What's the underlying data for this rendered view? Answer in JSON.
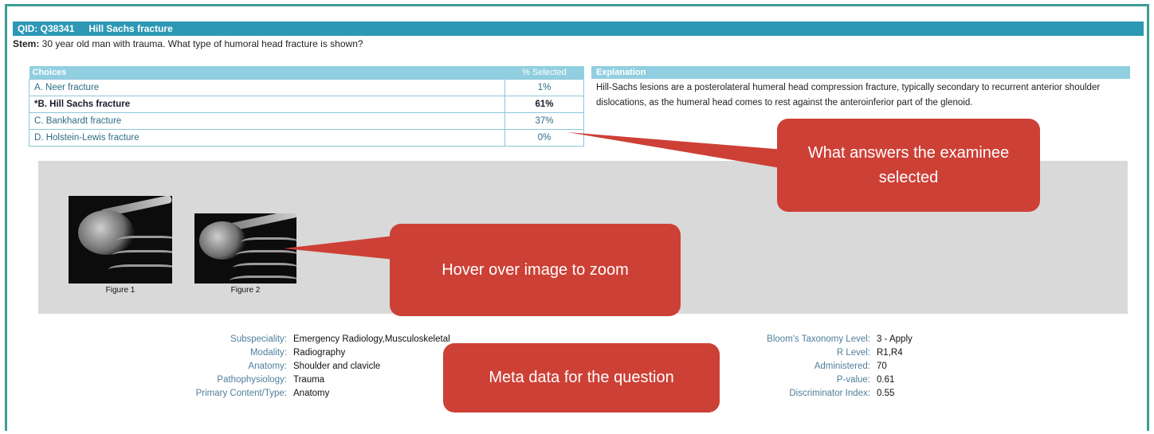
{
  "header": {
    "qid": "QID: Q38341",
    "title": "Hill Sachs fracture"
  },
  "stem": {
    "label": "Stem:",
    "text": " 30 year old man with trauma. What type of humoral head fracture is shown?"
  },
  "choices": {
    "header_label": "Choices",
    "pct_header": "% Selected",
    "rows": [
      {
        "label": "A. Neer fracture",
        "pct": "1%"
      },
      {
        "label": "*B. Hill Sachs fracture",
        "pct": "61%"
      },
      {
        "label": "C. Bankhardt fracture",
        "pct": "37%"
      },
      {
        "label": "D. Holstein-Lewis fracture",
        "pct": "0%"
      }
    ]
  },
  "explanation": {
    "header_label": "Explanation",
    "text": "Hill-Sachs lesions are a posterolateral humeral head compression fracture, typically secondary to recurrent anterior shoulder dislocations, as the humeral head comes to rest against the anteroinferior part of the glenoid."
  },
  "figures": [
    {
      "label": "Figure 1"
    },
    {
      "label": "Figure 2"
    }
  ],
  "meta_left": [
    {
      "key": "Subspeciality:",
      "value": "Emergency Radiology,Musculoskeletal"
    },
    {
      "key": "Modality:",
      "value": "Radiography"
    },
    {
      "key": "Anatomy:",
      "value": "Shoulder and clavicle"
    },
    {
      "key": "Pathophysiology:",
      "value": "Trauma"
    },
    {
      "key": "Primary Content/Type:",
      "value": "Anatomy"
    }
  ],
  "meta_right": [
    {
      "key": "Bloom's Taxonomy Level:",
      "value": "3 - Apply"
    },
    {
      "key": "R Level:",
      "value": "R1,R4"
    },
    {
      "key": "Administered:",
      "value": "70"
    },
    {
      "key": "P-value:",
      "value": "0.61"
    },
    {
      "key": "Discriminator Index:",
      "value": "0.55"
    }
  ],
  "callouts": {
    "answers": "What answers the examinee selected",
    "hover": "Hover over image to zoom",
    "meta": "Meta data for the question"
  },
  "colors": {
    "header": "#2c98b5",
    "subheader": "#91cfe0",
    "callout": "#cd4036",
    "frame": "#3c9d93",
    "panel": "#d9d9d9"
  }
}
